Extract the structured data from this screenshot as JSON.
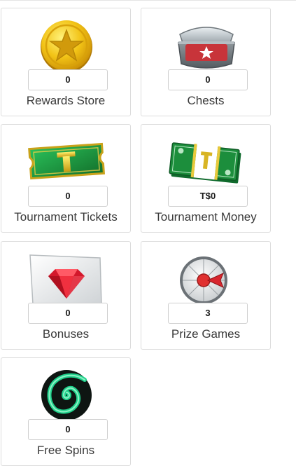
{
  "tiles": [
    {
      "label": "Rewards Store",
      "value": "0",
      "icon": "gold-star-coin-icon"
    },
    {
      "label": "Chests",
      "value": "0",
      "icon": "treasure-chest-icon"
    },
    {
      "label": "Tournament Tickets",
      "value": "0",
      "icon": "tournament-ticket-icon"
    },
    {
      "label": "Tournament Money",
      "value": "T$0",
      "icon": "tournament-money-icon"
    },
    {
      "label": "Bonuses",
      "value": "0",
      "icon": "ruby-gem-card-icon"
    },
    {
      "label": "Prize Games",
      "value": "3",
      "icon": "prize-wheel-icon"
    },
    {
      "label": "Free Spins",
      "value": "0",
      "icon": "green-swirl-icon"
    }
  ],
  "colors": {
    "ticket_green": "#1f9a3f",
    "coin_gold": "#f2c316",
    "chest_red": "#c8343a",
    "ruby_red": "#d3182c",
    "swirl_green": "#1fd28c"
  }
}
